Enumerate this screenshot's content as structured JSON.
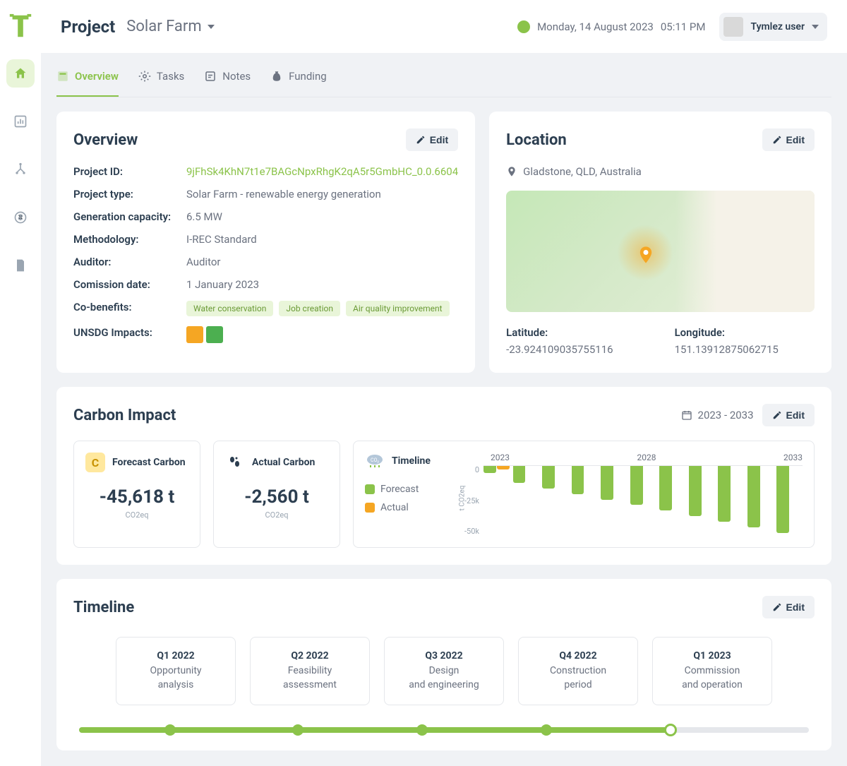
{
  "header": {
    "title": "Project",
    "project_name": "Solar Farm",
    "date": "Monday, 14 August 2023",
    "time": "05:11 PM",
    "user": "Tymlez user"
  },
  "tabs": [
    {
      "label": "Overview",
      "active": true
    },
    {
      "label": "Tasks",
      "active": false
    },
    {
      "label": "Notes",
      "active": false
    },
    {
      "label": "Funding",
      "active": false
    }
  ],
  "overview": {
    "title": "Overview",
    "edit": "Edit",
    "fields": {
      "project_id_label": "Project ID:",
      "project_id": "9jFhSk4KhN7t1e7BAGcNpxRhgK2qA5r5GmbHC_0.0.6604",
      "project_type_label": "Project type:",
      "project_type": "Solar Farm - renewable energy generation",
      "capacity_label": "Generation capacity:",
      "capacity": "6.5 MW",
      "methodology_label": "Methodology:",
      "methodology": "I-REC Standard",
      "auditor_label": "Auditor:",
      "auditor": "Auditor",
      "commission_label": "Comission date:",
      "commission": "1 January 2023",
      "cobenefits_label": "Co-benefits:",
      "cobenefits": [
        "Water conservation",
        "Job creation",
        "Air quality improvement"
      ],
      "unsdg_label": "UNSDG Impacts:"
    }
  },
  "location": {
    "title": "Location",
    "edit": "Edit",
    "place": "Gladstone, QLD, Australia",
    "lat_label": "Latitude:",
    "lat": "-23.924109035755116",
    "lon_label": "Longitude:",
    "lon": "151.13912875062715"
  },
  "carbon": {
    "title": "Carbon Impact",
    "range": "2023 - 2033",
    "edit": "Edit",
    "forecast_label": "Forecast Carbon",
    "forecast_value": "-45,618 t",
    "actual_label": "Actual Carbon",
    "actual_value": "-2,560 t",
    "unit": "CO2eq",
    "timeline_label": "Timeline",
    "legend_forecast": "Forecast",
    "legend_actual": "Actual",
    "ylabel": "t CO2eq",
    "yticks": [
      "0",
      "-25k",
      "-50k"
    ]
  },
  "chart_data": {
    "type": "bar",
    "title": "Timeline",
    "xlabel": "",
    "ylabel": "t CO2eq",
    "ylim": [
      -50000,
      0
    ],
    "x_tick_labels_shown": [
      "2023",
      "2028",
      "2033"
    ],
    "categories": [
      "2023",
      "2024",
      "2025",
      "2026",
      "2027",
      "2028",
      "2029",
      "2030",
      "2031",
      "2032",
      "2033"
    ],
    "series": [
      {
        "name": "Forecast",
        "color": "#8bc34a",
        "values": [
          -5000,
          -12000,
          -16000,
          -20000,
          -24000,
          -28000,
          -32000,
          -36000,
          -40000,
          -44000,
          -48000
        ]
      },
      {
        "name": "Actual",
        "color": "#f5a623",
        "values": [
          -2560,
          null,
          null,
          null,
          null,
          null,
          null,
          null,
          null,
          null,
          null
        ]
      }
    ]
  },
  "timeline": {
    "title": "Timeline",
    "edit": "Edit",
    "phases": [
      {
        "q": "Q1 2022",
        "d1": "Opportunity",
        "d2": "analysis"
      },
      {
        "q": "Q2 2022",
        "d1": "Feasibility",
        "d2": "assessment"
      },
      {
        "q": "Q3 2022",
        "d1": "Design",
        "d2": "and engineering"
      },
      {
        "q": "Q4 2022",
        "d1": "Construction",
        "d2": "period"
      },
      {
        "q": "Q1 2023",
        "d1": "Commission",
        "d2": "and operation"
      }
    ]
  }
}
